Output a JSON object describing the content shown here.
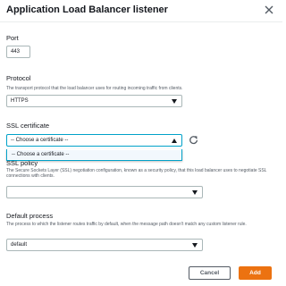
{
  "dialog": {
    "title": "Application Load Balancer listener"
  },
  "port": {
    "label": "Port",
    "value": "443"
  },
  "protocol": {
    "label": "Protocol",
    "description": "The transport protocol that the load balancer uses for routing incoming traffic from clients.",
    "value": "HTTPS"
  },
  "ssl_certificate": {
    "label": "SSL certificate",
    "value": "-- Choose a certificate --",
    "options": [
      "-- Choose a certificate --"
    ]
  },
  "ssl_policy": {
    "label": "SSL policy",
    "description": "The Secure Sockets Layer (SSL) negotiation configuration, known as a security policy, that this load balancer uses to negotiate SSL connections with clients.",
    "value": ""
  },
  "default_process": {
    "label": "Default process",
    "description": "The process to which the listener routes traffic by default, when the message path doesn't match any custom listener rule.",
    "value": "default"
  },
  "footer": {
    "cancel_label": "Cancel",
    "add_label": "Add"
  },
  "colors": {
    "primary": "#ec7211",
    "focus": "#00a1c9",
    "border": "#aab7b8",
    "text": "#16191f",
    "secondary_text": "#545b64"
  },
  "icons": {
    "close": "close-icon",
    "refresh": "refresh-icon",
    "caret": "caret-down-icon"
  }
}
